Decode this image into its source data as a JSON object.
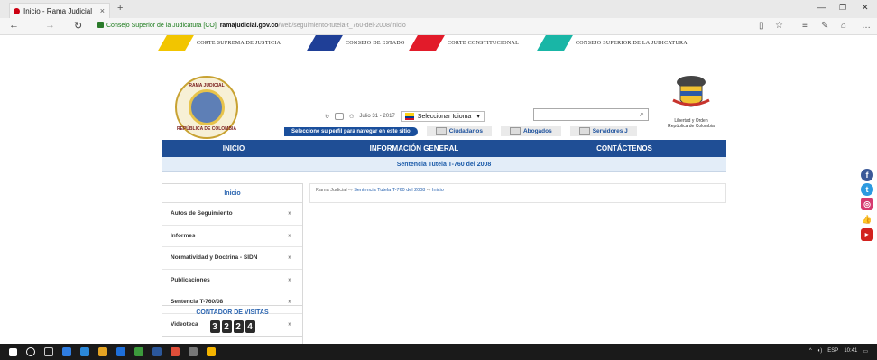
{
  "browser": {
    "tab_title": "Inicio - Rama Judicial",
    "tab_close": "×",
    "new_tab": "+",
    "url_org": "Consejo Superior de la Judicatura [CO]",
    "url_host": "ramajudicial.gov.co",
    "url_path": "/web/seguimiento-tutela-t_760-del-2008/inicio",
    "window_controls": [
      "—",
      "❐",
      "✕"
    ],
    "nav": {
      "back": "←",
      "forward": "→",
      "refresh": "↻"
    }
  },
  "colorbar": [
    {
      "label": "CORTE SUPREMA DE JUSTICIA",
      "color": "#f2c500"
    },
    {
      "label": "CONSEJO DE ESTADO",
      "color": "#1f3f97"
    },
    {
      "label": "CORTE CONSTITUCIONAL",
      "color": "#e21b2a"
    },
    {
      "label": "CONSEJO SUPERIOR DE LA JUDICATURA",
      "color": "#19b6a6"
    }
  ],
  "header": {
    "seal_top": "RAMA JUDICIAL",
    "seal_bottom": "REPÚBLICA DE COLOMBIA",
    "date": "Julio 31 - 2017",
    "language_select": "Seleccionar Idioma",
    "coat_caption_1": "Libertad y Orden",
    "coat_caption_2": "República de Colombia"
  },
  "profile_bar": {
    "prompt": "Seleccione su perfil para navegar en este sitio",
    "profiles": [
      "Ciudadanos",
      "Abogados",
      "Servidores J"
    ]
  },
  "main_nav": [
    "INICIO",
    "INFORMACIÓN GENERAL",
    "CONTÁCTENOS"
  ],
  "page_heading": "Sentencia Tutela T-760 del 2008",
  "sidebar": {
    "title": "Inicio",
    "items": [
      "Autos de Seguimiento",
      "Informes",
      "Normatividad y Doctrina - SIDN",
      "Publicaciones",
      "Sentencia T-760/08",
      "Videoteca"
    ],
    "arrow": "»"
  },
  "counter": {
    "label": "CONTADOR DE VISITAS",
    "digits": [
      "3",
      "2",
      "2",
      "4"
    ]
  },
  "breadcrumb": {
    "root": "Rama Judicial",
    "level1": "Sentencia Tutela T-760 del 2008",
    "level2": "Inicio",
    "sep": "⇨"
  },
  "social": [
    {
      "name": "facebook",
      "glyph": "f",
      "color": "#3b5998"
    },
    {
      "name": "twitter",
      "glyph": "t",
      "color": "#2c9ae0"
    },
    {
      "name": "instagram",
      "glyph": "◎",
      "color": "#d63a6f"
    },
    {
      "name": "like",
      "glyph": "👍",
      "color": "#3b5998"
    },
    {
      "name": "youtube",
      "glyph": "▶",
      "color": "#d2221e"
    }
  ],
  "taskbar": {
    "tray_lang": "ESP",
    "tray_time": "10:41"
  }
}
